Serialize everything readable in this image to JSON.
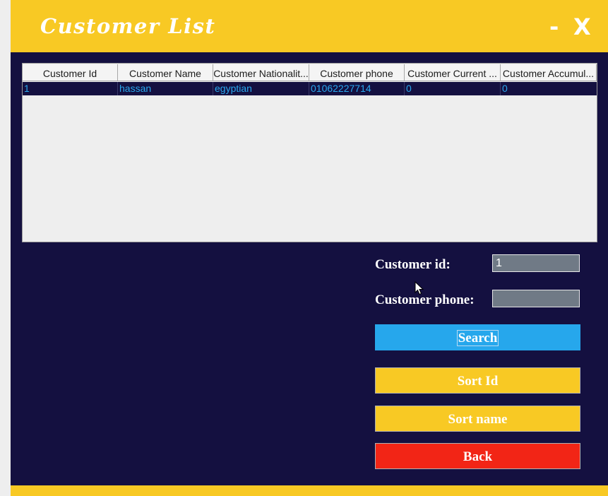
{
  "window": {
    "title": "Customer List",
    "minimize_label": "-",
    "close_label": "X"
  },
  "table": {
    "columns": [
      "Customer Id",
      "Customer Name",
      "Customer Nationalit...",
      "Customer phone",
      "Customer Current ...",
      "Customer Accumul..."
    ],
    "rows": [
      [
        "1",
        "hassan",
        "egyptian",
        "01062227714",
        "0",
        "0"
      ]
    ]
  },
  "form": {
    "id_label": "Customer id:",
    "id_value": "1",
    "phone_label": "Customer phone:",
    "phone_value": ""
  },
  "buttons": {
    "search": "Search",
    "sort_id": "Sort Id",
    "sort_name": "Sort name",
    "back": "Back"
  },
  "colors": {
    "primary": "#f8c924",
    "background": "#141040",
    "search": "#26a7ec",
    "back": "#f22516"
  }
}
